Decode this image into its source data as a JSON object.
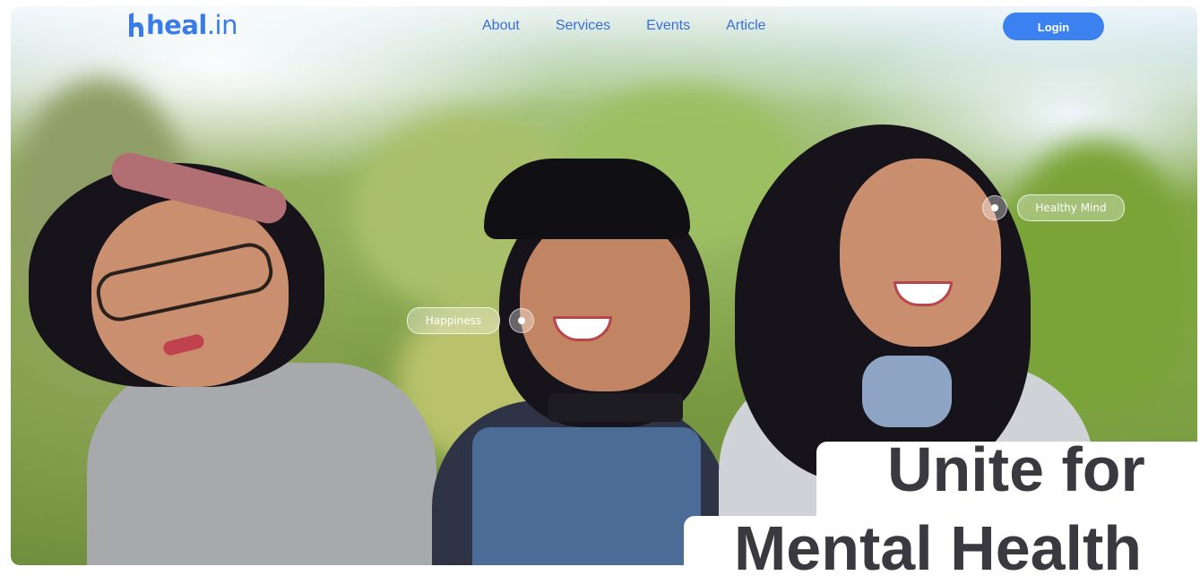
{
  "nav": {
    "logo_text": "heal",
    "logo_suffix": ".in",
    "menu": [
      "About",
      "Services",
      "Events",
      "Article"
    ],
    "login_label": "Login"
  },
  "hero": {
    "image_icon": "three-smiling-girls-photo",
    "tags": [
      "Happiness",
      "Healthy Mind"
    ],
    "headline_line1": "Unite for",
    "headline_line2": "Mental Health"
  },
  "colors": {
    "brand": "#3a7be8",
    "login_bg": "#3b82f0",
    "headline": "#3a393f"
  }
}
